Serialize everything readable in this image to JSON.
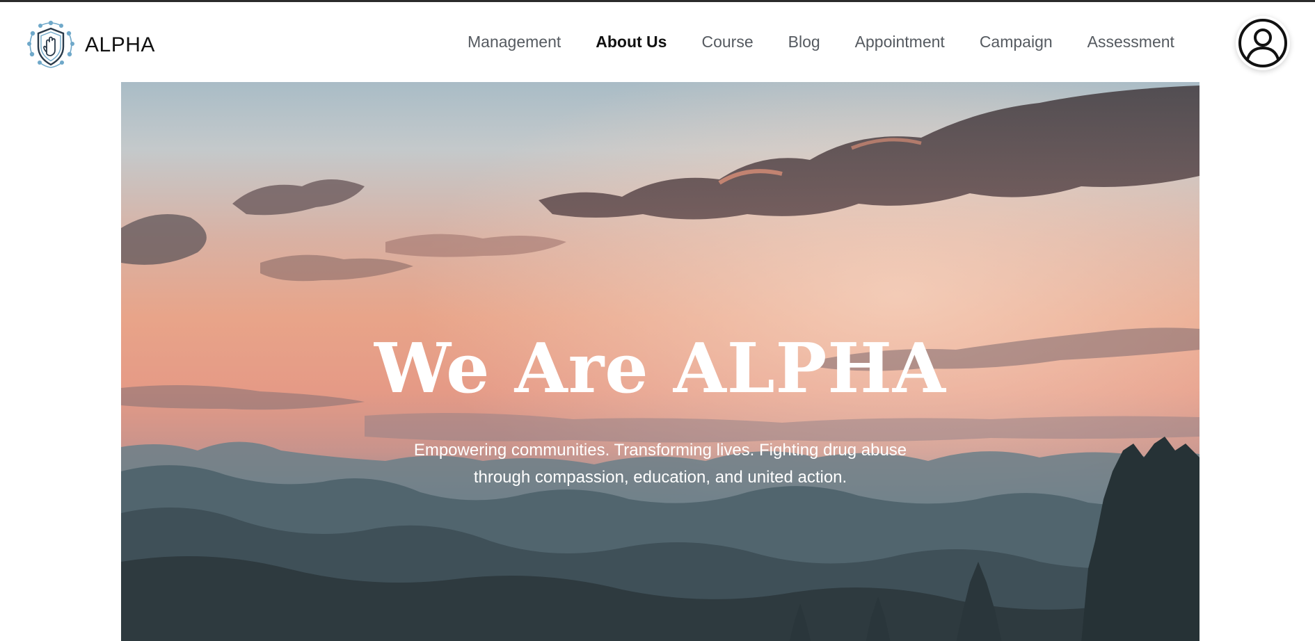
{
  "brand": {
    "name": "ALPHA",
    "logo_icon": "shield-hand-icon",
    "logo_colors": [
      "#6fa8c9",
      "#2a3a4a"
    ]
  },
  "nav": {
    "items": [
      {
        "label": "Management",
        "active": false
      },
      {
        "label": "About Us",
        "active": true
      },
      {
        "label": "Course",
        "active": false
      },
      {
        "label": "Blog",
        "active": false
      },
      {
        "label": "Appointment",
        "active": false
      },
      {
        "label": "Campaign",
        "active": false
      },
      {
        "label": "Assessment",
        "active": false
      }
    ]
  },
  "profile": {
    "icon": "user-profile-icon"
  },
  "hero": {
    "title": "We Are ALPHA",
    "subtitle": "Empowering communities. Transforming lives. Fighting drug abuse through compassion, education, and united action.",
    "background": "sunset-mountains-image"
  },
  "colors": {
    "nav_text": "#555a60",
    "nav_active": "#111111",
    "hero_text": "#ffffff"
  }
}
